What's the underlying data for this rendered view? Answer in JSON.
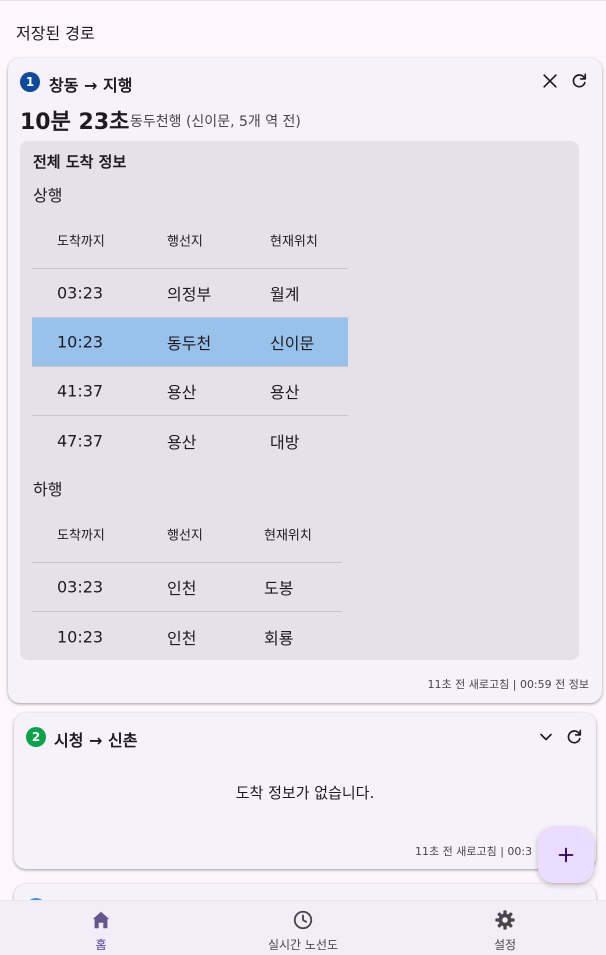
{
  "app": {
    "title": "저장된 경로"
  },
  "colors": {
    "badge1": "#0d4a9c",
    "badge2": "#0aa14b",
    "badge3": "#2f9bd1",
    "highlight_row": "#99c2eb",
    "accent": "#65558f"
  },
  "routes": [
    {
      "index": "1",
      "title": "창동 → 지행",
      "eta": "10분 23초",
      "eta_detail": "동두천행 (신이문, 5개 역 전)",
      "info_title": "전체 도착 정보",
      "up": {
        "label": "상행",
        "headers": [
          "도착까지",
          "행선지",
          "현재위치"
        ],
        "rows": [
          [
            "03:23",
            "의정부",
            "월계"
          ],
          [
            "10:23",
            "동두천",
            "신이문"
          ],
          [
            "41:37",
            "용산",
            "용산"
          ],
          [
            "47:37",
            "용산",
            "대방"
          ]
        ],
        "highlighted_row": 1
      },
      "down": {
        "label": "하행",
        "headers": [
          "도착까지",
          "행선지",
          "현재위치"
        ],
        "rows": [
          [
            "03:23",
            "인천",
            "도봉"
          ],
          [
            "10:23",
            "인천",
            "회룡"
          ]
        ]
      },
      "footer": "11초 전 새로고침 | 00:59 전 정보",
      "icons": [
        "close-icon",
        "refresh-icon"
      ]
    },
    {
      "index": "2",
      "title": "시청 → 신촌",
      "empty_message": "도착 정보가 없습니다.",
      "footer": "11초 전 새로고침 | 00:3",
      "icons": [
        "chevron-down-icon",
        "refresh-icon"
      ]
    }
  ],
  "fab": {
    "icon": "add-icon"
  },
  "bottom_nav": {
    "items": [
      {
        "label": "홈",
        "icon": "home-icon",
        "active": true
      },
      {
        "label": "실시간 노선도",
        "icon": "clock-icon",
        "active": false
      },
      {
        "label": "설정",
        "icon": "settings-icon",
        "active": false
      }
    ]
  }
}
